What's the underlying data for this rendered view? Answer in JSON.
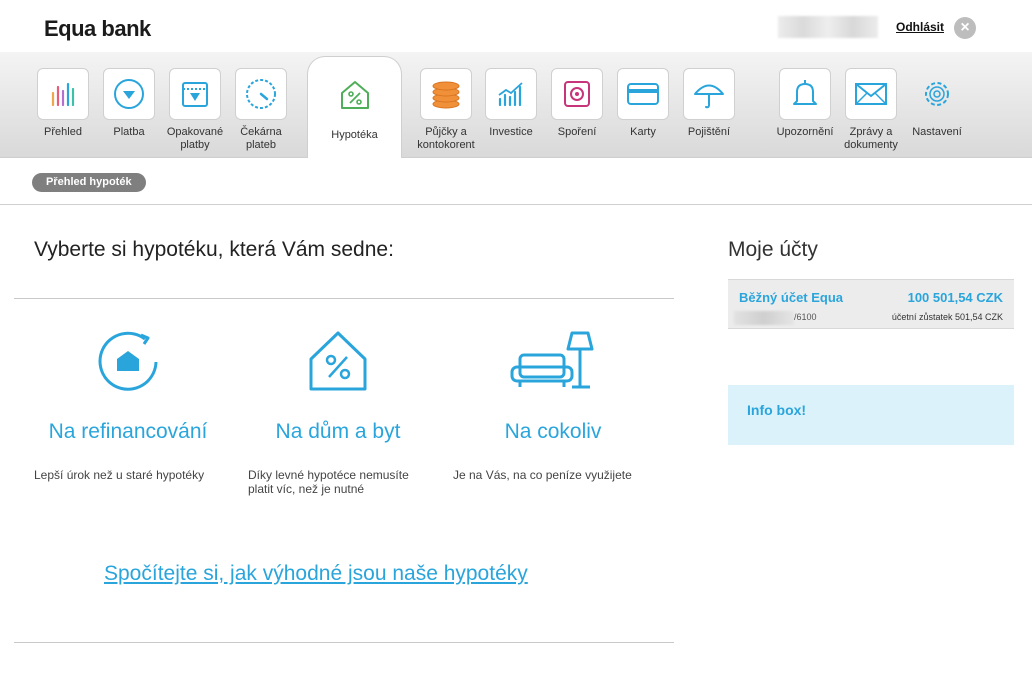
{
  "brand": {
    "logo": "Equa bank"
  },
  "header": {
    "logout_label": "Odhlásit",
    "close_glyph": "×"
  },
  "nav": {
    "items": [
      {
        "label": "Přehled",
        "icon": "bar-chart-icon"
      },
      {
        "label": "Platba",
        "icon": "payment-icon"
      },
      {
        "label": "Opakované\nplatby",
        "icon": "calendar-icon"
      },
      {
        "label": "Čekárna\nplateb",
        "icon": "clock-icon"
      },
      {
        "label": "Hypotéka",
        "icon": "house-percent-icon",
        "active": true
      },
      {
        "label": "Půjčky a\nkontokorent",
        "icon": "coins-icon"
      },
      {
        "label": "Investice",
        "icon": "investment-chart-icon"
      },
      {
        "label": "Spoření",
        "icon": "safe-icon"
      },
      {
        "label": "Karty",
        "icon": "card-icon"
      },
      {
        "label": "Pojištění",
        "icon": "umbrella-icon"
      },
      {
        "label": "Upozornění",
        "icon": "bell-icon"
      },
      {
        "label": "Zprávy a\ndokumenty",
        "icon": "envelope-icon"
      },
      {
        "label": "Nastavení",
        "icon": "gear-icon"
      }
    ]
  },
  "breadcrumb": {
    "label": "Přehled hypoték"
  },
  "main": {
    "title": "Vyberte si hypotéku, která Vám sedne:",
    "options": [
      {
        "title": "Na refinancování",
        "desc": "Lepší úrok než u staré hypotéky",
        "icon": "refinance-house-icon"
      },
      {
        "title": "Na dům a byt",
        "desc": "Díky levné hypotéce nemusíte platit víc, než je nutné",
        "icon": "house-percent-icon"
      },
      {
        "title": "Na cokoliv",
        "desc": "Je na Vás, na co peníze využijete",
        "icon": "sofa-lamp-icon"
      }
    ],
    "calc_link": "Spočítejte si, jak výhodné jsou naše hypotéky"
  },
  "sidebar": {
    "title": "Moje účty",
    "account": {
      "name": "Běžný účet Equa",
      "amount": "100 501,54 CZK",
      "number_suffix": "/6100",
      "balance": "účetní zůstatek 501,54 CZK"
    },
    "infobox_title": "Info box!"
  },
  "colors": {
    "accent": "#2aa5dc",
    "nav_bg": "#e3e3e3",
    "infobox_bg": "#dcf2fb"
  }
}
